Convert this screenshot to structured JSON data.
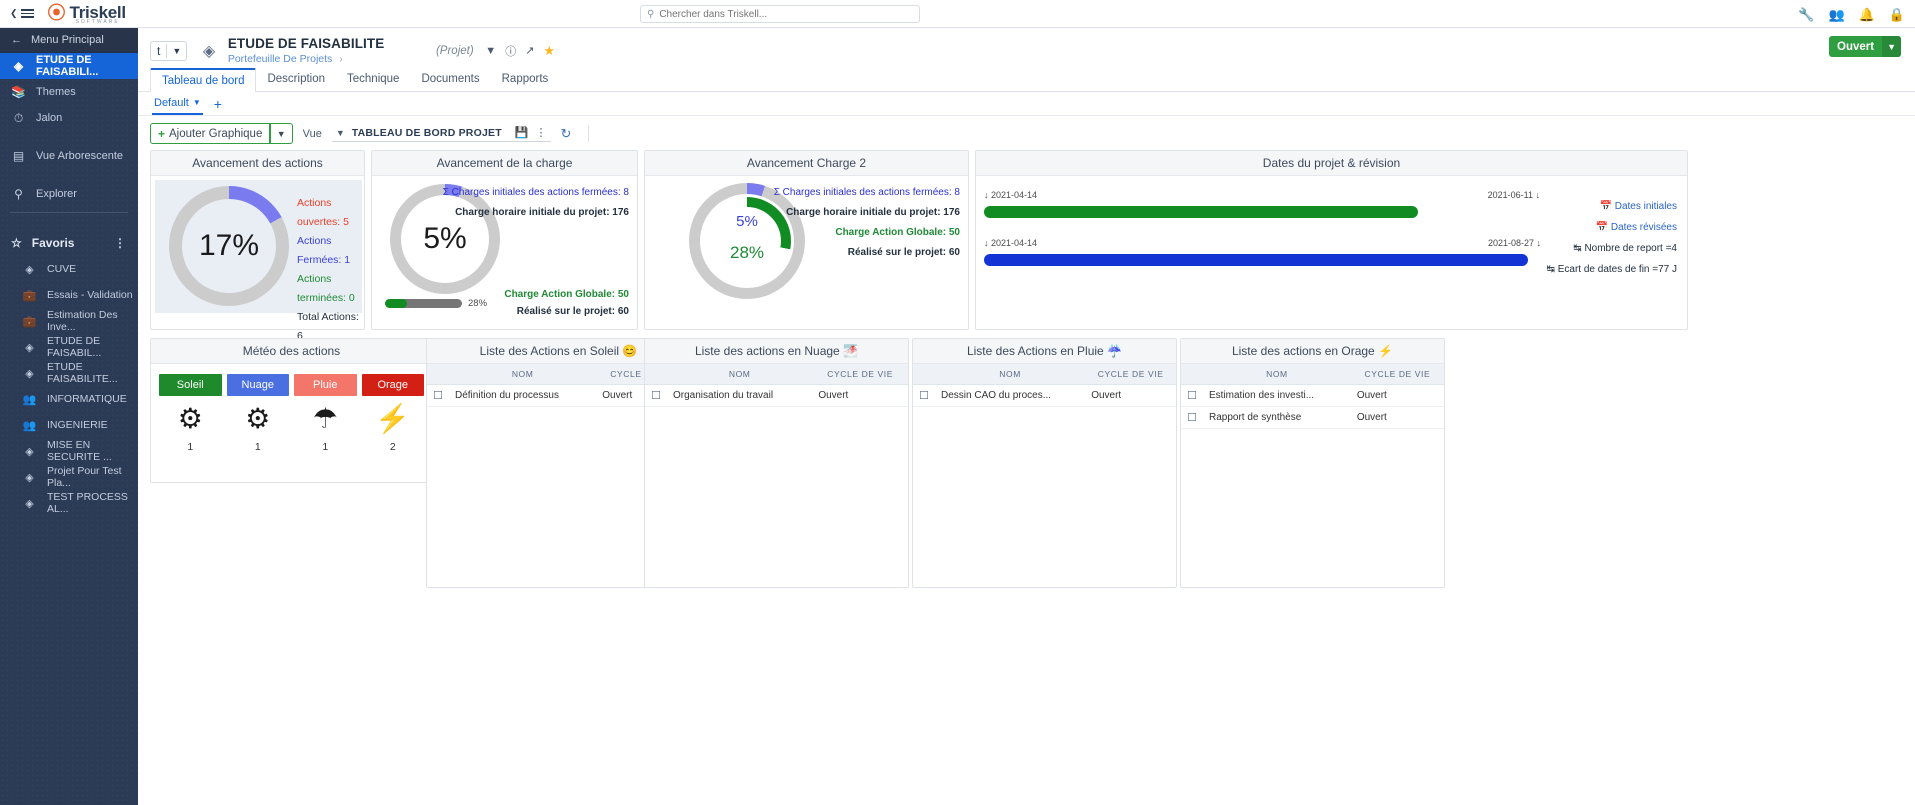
{
  "topbar": {
    "brand_name": "Triskell",
    "brand_sub": "SOFTWARE",
    "search_placeholder": "Chercher dans Triskell...",
    "icons": [
      "wrench-icon",
      "users-icon",
      "bell-icon",
      "lock-icon"
    ]
  },
  "sidebar": {
    "back_label": "Menu Principal",
    "active_item": "ETUDE DE FAISABILI...",
    "items": [
      {
        "label": "Themes",
        "icon": "books-icon"
      },
      {
        "label": "Jalon",
        "icon": "clock-icon"
      },
      {
        "label": "Vue Arborescente",
        "icon": "tree-icon"
      },
      {
        "label": "Explorer",
        "icon": "search-icon"
      }
    ],
    "favorites_label": "Favoris",
    "favorites": [
      {
        "label": "CUVE",
        "icon": "cube-icon"
      },
      {
        "label": "Essais - Validation",
        "icon": "briefcase-icon"
      },
      {
        "label": "Estimation Des Inve...",
        "icon": "briefcase-icon"
      },
      {
        "label": "ETUDE DE FAISABIL...",
        "icon": "cube-icon"
      },
      {
        "label": "ETUDE FAISABILITE...",
        "icon": "cube-icon"
      },
      {
        "label": "INFORMATIQUE",
        "icon": "people-icon"
      },
      {
        "label": "INGENIERIE",
        "icon": "people-icon"
      },
      {
        "label": "MISE EN SECURITE ...",
        "icon": "cube-icon"
      },
      {
        "label": "Projet Pour Test Pla...",
        "icon": "cube-icon"
      },
      {
        "label": "TEST PROCESS AL...",
        "icon": "cube-icon"
      }
    ]
  },
  "header": {
    "type_badge": "t",
    "title": "ETUDE DE FAISABILITE",
    "breadcrumb": "Portefeuille De Projets",
    "entity_type": "(Projet)",
    "status": "Ouvert",
    "tabs": [
      {
        "label": "Tableau de bord",
        "active": true
      },
      {
        "label": "Description",
        "active": false
      },
      {
        "label": "Technique",
        "active": false
      },
      {
        "label": "Documents",
        "active": false
      },
      {
        "label": "Rapports",
        "active": false
      }
    ],
    "subtab": "Default",
    "add_subtab": "+"
  },
  "toolbar": {
    "add_chart_label": "Ajouter Graphique",
    "vue_label": "Vue",
    "vue_value": "TABLEAU DE BORD PROJET",
    "save_icon": "save-icon",
    "more_icon": "kebab-menu-icon",
    "refresh_icon": "refresh-icon"
  },
  "cards": {
    "actions_progress": {
      "title": "Avancement des actions",
      "percent_label": "17%",
      "percent_value": 17,
      "stats": [
        {
          "label": "Actions ouvertes: 5",
          "color": "#e8412a"
        },
        {
          "label": "Actions Fermées: 1",
          "color": "#3b42d6"
        },
        {
          "label": "Actions terminées: 0",
          "color": "#1f8a35"
        },
        {
          "label": "Total Actions: 6",
          "color": "#23303f"
        }
      ]
    },
    "charge_progress": {
      "title": "Avancement de la charge",
      "percent_label": "5%",
      "percent_value": 5,
      "legend": [
        {
          "label": "Σ Charges initiales des actions fermées: 8",
          "color": "#2b2fd1"
        },
        {
          "label": "Charge horaire initiale du projet: 176",
          "color": "#22303f"
        }
      ],
      "bottom_legend": [
        {
          "label": "Charge Action Globale: 50",
          "color": "#1f8a35"
        },
        {
          "label": "Réalisé sur le projet: 60",
          "color": "#22303f"
        }
      ],
      "progress_bar_label": "28%",
      "progress_bar_value": 28
    },
    "charge2": {
      "title": "Avancement Charge 2",
      "outer_percent_label": "5%",
      "outer_percent_value": 5,
      "inner_percent_label": "28%",
      "inner_percent_value": 28,
      "legend": [
        {
          "label": "Σ Charges initiales des actions fermées: 8",
          "color": "#2b2fd1"
        },
        {
          "label": "Charge horaire initiale du projet: 176",
          "color": "#22303f"
        },
        {
          "label": "Charge Action Globale: 50",
          "color": "#1f8a35"
        },
        {
          "label": "Réalisé sur le projet: 60",
          "color": "#22303f"
        }
      ]
    },
    "dates": {
      "title": "Dates du projet & révision",
      "row1": {
        "start": "2021-04-14",
        "end": "2021-06-11",
        "color": "#118c22"
      },
      "row2": {
        "start": "2021-04-14",
        "end": "2021-08-27",
        "color": "#1433d4"
      },
      "legend": [
        {
          "label": "Dates initiales",
          "icon": "calendar-icon",
          "color": "#2b64c4"
        },
        {
          "label": "Dates révisées",
          "icon": "calendar-icon",
          "color": "#2b64c4"
        },
        {
          "label": "Nombre de report =4",
          "icon": "metric-icon",
          "color": "#22303f"
        },
        {
          "label": "Ecart de dates de fin =77 J",
          "icon": "metric-icon",
          "color": "#22303f"
        }
      ]
    },
    "weather": {
      "title": "Météo des actions",
      "columns": [
        {
          "label": "Soleil",
          "color": "#1f8a2c",
          "icon": "sun-icon",
          "count": "1"
        },
        {
          "label": "Nuage",
          "color": "#4a6fe0",
          "icon": "cloud-icon",
          "count": "1"
        },
        {
          "label": "Pluie",
          "color": "#f4766a",
          "icon": "rain-icon",
          "count": "1"
        },
        {
          "label": "Orage",
          "color": "#d32015",
          "icon": "storm-icon",
          "count": "2"
        }
      ]
    },
    "list_soleil": {
      "title": "Liste des Actions en Soleil",
      "title_icon": "sun-emoji",
      "headers": [
        "",
        "NOM",
        "CYCLE DE VIE"
      ],
      "rows": [
        {
          "name": "Définition du processus",
          "lifecycle": "Ouvert"
        }
      ]
    },
    "list_nuage": {
      "title": "Liste des actions en Nuage",
      "title_icon": "cloud-emoji",
      "headers": [
        "",
        "NOM",
        "CYCLE DE VIE"
      ],
      "rows": [
        {
          "name": "Organisation du travail",
          "lifecycle": "Ouvert"
        }
      ]
    },
    "list_pluie": {
      "title": "Liste des Actions en Pluie",
      "title_icon": "umbrella-emoji",
      "headers": [
        "",
        "NOM",
        "CYCLE DE VIE"
      ],
      "rows": [
        {
          "name": "Dessin CAO du proces...",
          "lifecycle": "Ouvert"
        }
      ]
    },
    "list_orage": {
      "title": "Liste des actions en Orage",
      "title_icon": "bolt-emoji",
      "headers": [
        "",
        "NOM",
        "CYCLE DE VIE"
      ],
      "rows": [
        {
          "name": "Estimation des investi...",
          "lifecycle": "Ouvert"
        },
        {
          "name": "Rapport de synthèse",
          "lifecycle": "Ouvert"
        }
      ]
    }
  }
}
